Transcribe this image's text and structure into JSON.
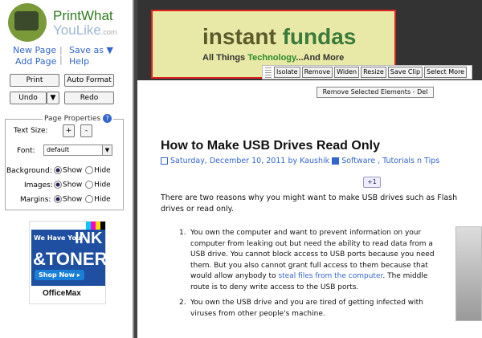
{
  "sidebar": {
    "logo": {
      "line1": "PrintWhat",
      "line2": "YouLike",
      "suffix": ".com"
    },
    "links": {
      "new_page": "New Page",
      "save_as": "Save as ▼",
      "add_page": "Add Page",
      "help": "Help"
    },
    "buttons": {
      "print": "Print",
      "auto_format": "Auto Format",
      "undo": "Undo",
      "undo_arrow": "▼",
      "redo": "Redo"
    },
    "page_properties": {
      "title": "Page Properties",
      "help_glyph": "?",
      "text_size_label": "Text Size:",
      "plus": "+",
      "minus": "-",
      "font_label": "Font:",
      "font_value": "default",
      "background_label": "Background:",
      "images_label": "Images:",
      "margins_label": "Margins:",
      "show": "Show",
      "hide": "Hide"
    },
    "ad": {
      "we_have_your": "We Have Your",
      "ink": "INK",
      "toner": "&TONER",
      "shop_now": "Shop Now ▸",
      "brand": "OfficeMax"
    }
  },
  "main": {
    "header": {
      "brand_a": "instant ",
      "brand_b": "fundas",
      "tag_a": "All Things ",
      "tag_b": "Technology",
      "tag_c": "...And More"
    },
    "toolbar": [
      "Isolate",
      "Remove",
      "Widen",
      "Resize",
      "Save Clip",
      "Select More"
    ],
    "remove_bar": "Remove Selected Elements - Del",
    "post": {
      "title": "How to Make USB Drives Read Only",
      "date": "Saturday, December 10, 2011 by Kaushik",
      "categories": "Software , Tutorials n Tips",
      "plusone": "+1",
      "intro": "There are two reasons why you might want to make USB drives such as Flash drives or read only.",
      "items": [
        {
          "num": "1.",
          "text_a": "You own the computer and want to prevent information on your computer from leaking out but need the ability to read data from a USB drive. You cannot block access to USB ports because you need them. But you also cannot grant full access to them because that would allow anybody to ",
          "link": "steal files from the computer",
          "text_b": ". The middle route is to deny write access to the USB ports."
        },
        {
          "num": "2.",
          "text_a": "You own the USB drive and you are tired of getting infected with viruses from other people's machine.",
          "link": "",
          "text_b": ""
        }
      ]
    }
  }
}
